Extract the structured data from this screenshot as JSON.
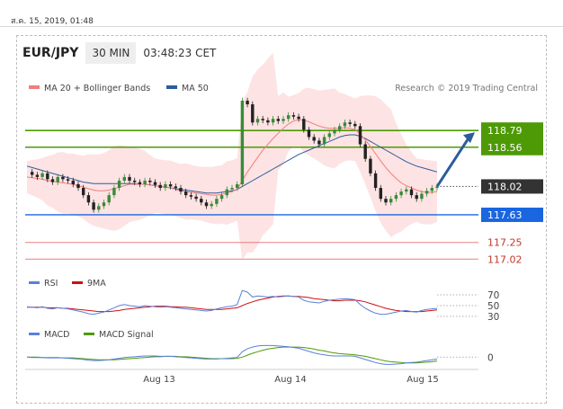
{
  "header": {
    "date_text": "ส.ค. 15, 2019, 01:48",
    "pair": "EUR/JPY",
    "timeframe": "30 MIN",
    "clock": "03:48:23 CET"
  },
  "colors": {
    "ma20": "#f07e7e",
    "ma50": "#2d5c9c",
    "bollinger_fill": "#fcd9d9",
    "candle_up": "#3a8a3a",
    "candle_down": "#222222",
    "resistance": "#4e9a06",
    "support_blue": "#1a66e0",
    "support_red": "#e88080",
    "last_price": "#333333",
    "rsi": "#5b80d8",
    "rsi_9ma": "#cc1111",
    "macd": "#5b80d8",
    "macd_signal": "#4e9a06",
    "arrow": "#2d5c9c"
  },
  "chart_data": [
    {
      "type": "line",
      "title": "",
      "legend": [
        "MA 20 + Bollinger Bands",
        "MA 50"
      ],
      "watermark": "Research © 2019 Trading Central",
      "x_labels": [
        "Aug 13",
        "Aug 14",
        "Aug 15"
      ],
      "ylim": [
        116.9,
        119.2
      ],
      "levels": {
        "resistance": [
          118.79,
          118.56
        ],
        "last": 118.02,
        "support": [
          117.63,
          117.25,
          117.02
        ]
      },
      "level_labels": {
        "r1": "118.79",
        "r2": "118.56",
        "last": "118.02",
        "s1": "117.63",
        "s2": "117.25",
        "s3": "117.02"
      },
      "close": [
        118.22,
        118.18,
        118.15,
        118.2,
        118.12,
        118.08,
        118.15,
        118.12,
        118.1,
        118.05,
        118.0,
        117.9,
        117.8,
        117.7,
        117.75,
        117.8,
        117.9,
        118.0,
        118.1,
        118.15,
        118.1,
        118.08,
        118.05,
        118.1,
        118.08,
        118.04,
        118.0,
        118.05,
        118.02,
        118.0,
        117.95,
        117.9,
        117.88,
        117.85,
        117.8,
        117.75,
        117.78,
        117.85,
        117.9,
        117.98,
        118.0,
        118.05,
        119.2,
        119.15,
        118.9,
        118.95,
        118.93,
        118.9,
        118.95,
        118.92,
        118.95,
        119.0,
        118.98,
        118.95,
        118.8,
        118.7,
        118.65,
        118.6,
        118.7,
        118.75,
        118.8,
        118.85,
        118.9,
        118.88,
        118.85,
        118.6,
        118.4,
        118.2,
        118.0,
        117.85,
        117.8,
        117.85,
        117.9,
        117.95,
        117.98,
        117.9,
        117.85,
        117.92,
        117.96,
        118.0,
        118.02
      ],
      "ma20": [
        118.15,
        118.14,
        118.13,
        118.12,
        118.1,
        118.09,
        118.08,
        118.07,
        118.06,
        118.05,
        118.03,
        118.01,
        117.99,
        117.97,
        117.96,
        117.96,
        117.97,
        117.99,
        118.01,
        118.03,
        118.05,
        118.05,
        118.05,
        118.05,
        118.04,
        118.03,
        118.02,
        118.01,
        118.0,
        117.98,
        117.96,
        117.95,
        117.94,
        117.93,
        117.92,
        117.91,
        117.9,
        117.9,
        117.91,
        117.93,
        117.95,
        117.98,
        118.1,
        118.22,
        118.32,
        118.42,
        118.52,
        118.6,
        118.68,
        118.75,
        118.82,
        118.88,
        118.92,
        118.94,
        118.93,
        118.91,
        118.88,
        118.85,
        118.83,
        118.82,
        118.82,
        118.82,
        118.83,
        118.82,
        118.8,
        118.74,
        118.66,
        118.57,
        118.47,
        118.37,
        118.28,
        118.2,
        118.13,
        118.07,
        118.03,
        118.0,
        117.97,
        117.95,
        117.94,
        117.94,
        117.95
      ],
      "ma50": [
        118.3,
        118.28,
        118.26,
        118.24,
        118.22,
        118.2,
        118.18,
        118.16,
        118.14,
        118.12,
        118.1,
        118.08,
        118.07,
        118.06,
        118.06,
        118.06,
        118.06,
        118.06,
        118.06,
        118.06,
        118.06,
        118.06,
        118.05,
        118.05,
        118.04,
        118.03,
        118.02,
        118.01,
        118.0,
        117.99,
        117.98,
        117.97,
        117.96,
        117.95,
        117.94,
        117.93,
        117.93,
        117.93,
        117.94,
        117.95,
        117.96,
        117.98,
        118.02,
        118.06,
        118.1,
        118.14,
        118.18,
        118.22,
        118.26,
        118.3,
        118.34,
        118.38,
        118.42,
        118.46,
        118.49,
        118.52,
        118.55,
        118.58,
        118.61,
        118.64,
        118.67,
        118.7,
        118.72,
        118.73,
        118.73,
        118.71,
        118.68,
        118.64,
        118.6,
        118.56,
        118.52,
        118.48,
        118.44,
        118.4,
        118.36,
        118.33,
        118.3,
        118.28,
        118.26,
        118.24,
        118.22
      ]
    },
    {
      "type": "line",
      "legend": [
        "RSI",
        "9MA"
      ],
      "levels": {
        "overbought": 70,
        "mid": 50,
        "oversold": 30
      },
      "level_labels": [
        "70",
        "50",
        "30"
      ],
      "ylim": [
        20,
        80
      ],
      "rsi": [
        48,
        47,
        46,
        48,
        45,
        44,
        46,
        45,
        44,
        42,
        40,
        38,
        35,
        34,
        36,
        38,
        42,
        46,
        50,
        52,
        50,
        49,
        48,
        50,
        49,
        48,
        47,
        48,
        47,
        46,
        45,
        44,
        43,
        42,
        41,
        40,
        41,
        44,
        46,
        48,
        49,
        52,
        78,
        75,
        66,
        68,
        67,
        66,
        67,
        66,
        67,
        68,
        67,
        66,
        60,
        57,
        56,
        55,
        58,
        60,
        61,
        62,
        63,
        62,
        61,
        52,
        45,
        40,
        36,
        34,
        34,
        36,
        38,
        40,
        41,
        39,
        38,
        41,
        43,
        44,
        45
      ],
      "rsi_9ma": [
        47,
        47,
        47,
        47,
        46,
        46,
        46,
        45,
        45,
        44,
        43,
        42,
        41,
        40,
        39,
        39,
        39,
        40,
        41,
        43,
        44,
        45,
        46,
        47,
        48,
        49,
        49,
        49,
        48,
        48,
        47,
        47,
        46,
        45,
        44,
        43,
        43,
        43,
        43,
        44,
        45,
        46,
        50,
        54,
        57,
        60,
        62,
        64,
        66,
        67,
        68,
        68,
        67,
        67,
        66,
        65,
        63,
        62,
        61,
        60,
        59,
        59,
        60,
        60,
        60,
        59,
        57,
        54,
        51,
        48,
        45,
        43,
        41,
        40,
        39,
        39,
        39,
        39,
        40,
        41,
        42
      ]
    },
    {
      "type": "line",
      "legend": [
        "MACD",
        "MACD Signal"
      ],
      "level_labels": [
        "0"
      ],
      "ylim": [
        -0.25,
        0.45
      ],
      "macd": [
        0.0,
        -0.01,
        -0.01,
        -0.01,
        -0.02,
        -0.02,
        -0.02,
        -0.02,
        -0.03,
        -0.04,
        -0.05,
        -0.06,
        -0.08,
        -0.09,
        -0.09,
        -0.08,
        -0.07,
        -0.05,
        -0.03,
        -0.01,
        0.0,
        0.01,
        0.02,
        0.03,
        0.03,
        0.03,
        0.02,
        0.02,
        0.02,
        0.01,
        0.0,
        -0.01,
        -0.02,
        -0.03,
        -0.04,
        -0.05,
        -0.05,
        -0.05,
        -0.04,
        -0.03,
        -0.02,
        -0.01,
        0.14,
        0.22,
        0.26,
        0.29,
        0.3,
        0.3,
        0.3,
        0.29,
        0.28,
        0.27,
        0.25,
        0.23,
        0.19,
        0.15,
        0.11,
        0.08,
        0.06,
        0.04,
        0.03,
        0.03,
        0.03,
        0.03,
        0.02,
        -0.02,
        -0.06,
        -0.1,
        -0.14,
        -0.17,
        -0.19,
        -0.19,
        -0.18,
        -0.17,
        -0.15,
        -0.14,
        -0.13,
        -0.11,
        -0.09,
        -0.07,
        -0.05
      ],
      "macd_signal": [
        0.0,
        0.0,
        0.0,
        -0.01,
        -0.01,
        -0.01,
        -0.01,
        -0.02,
        -0.02,
        -0.02,
        -0.03,
        -0.04,
        -0.05,
        -0.06,
        -0.07,
        -0.07,
        -0.07,
        -0.07,
        -0.06,
        -0.05,
        -0.04,
        -0.03,
        -0.02,
        -0.01,
        0.0,
        0.01,
        0.01,
        0.02,
        0.02,
        0.02,
        0.01,
        0.01,
        0.0,
        -0.01,
        -0.02,
        -0.03,
        -0.04,
        -0.04,
        -0.04,
        -0.04,
        -0.04,
        -0.03,
        0.0,
        0.05,
        0.1,
        0.14,
        0.18,
        0.21,
        0.23,
        0.25,
        0.26,
        0.26,
        0.26,
        0.26,
        0.25,
        0.23,
        0.21,
        0.18,
        0.16,
        0.13,
        0.11,
        0.09,
        0.08,
        0.07,
        0.06,
        0.04,
        0.02,
        -0.01,
        -0.04,
        -0.07,
        -0.1,
        -0.12,
        -0.13,
        -0.14,
        -0.15,
        -0.15,
        -0.15,
        -0.14,
        -0.13,
        -0.12,
        -0.1
      ]
    }
  ]
}
